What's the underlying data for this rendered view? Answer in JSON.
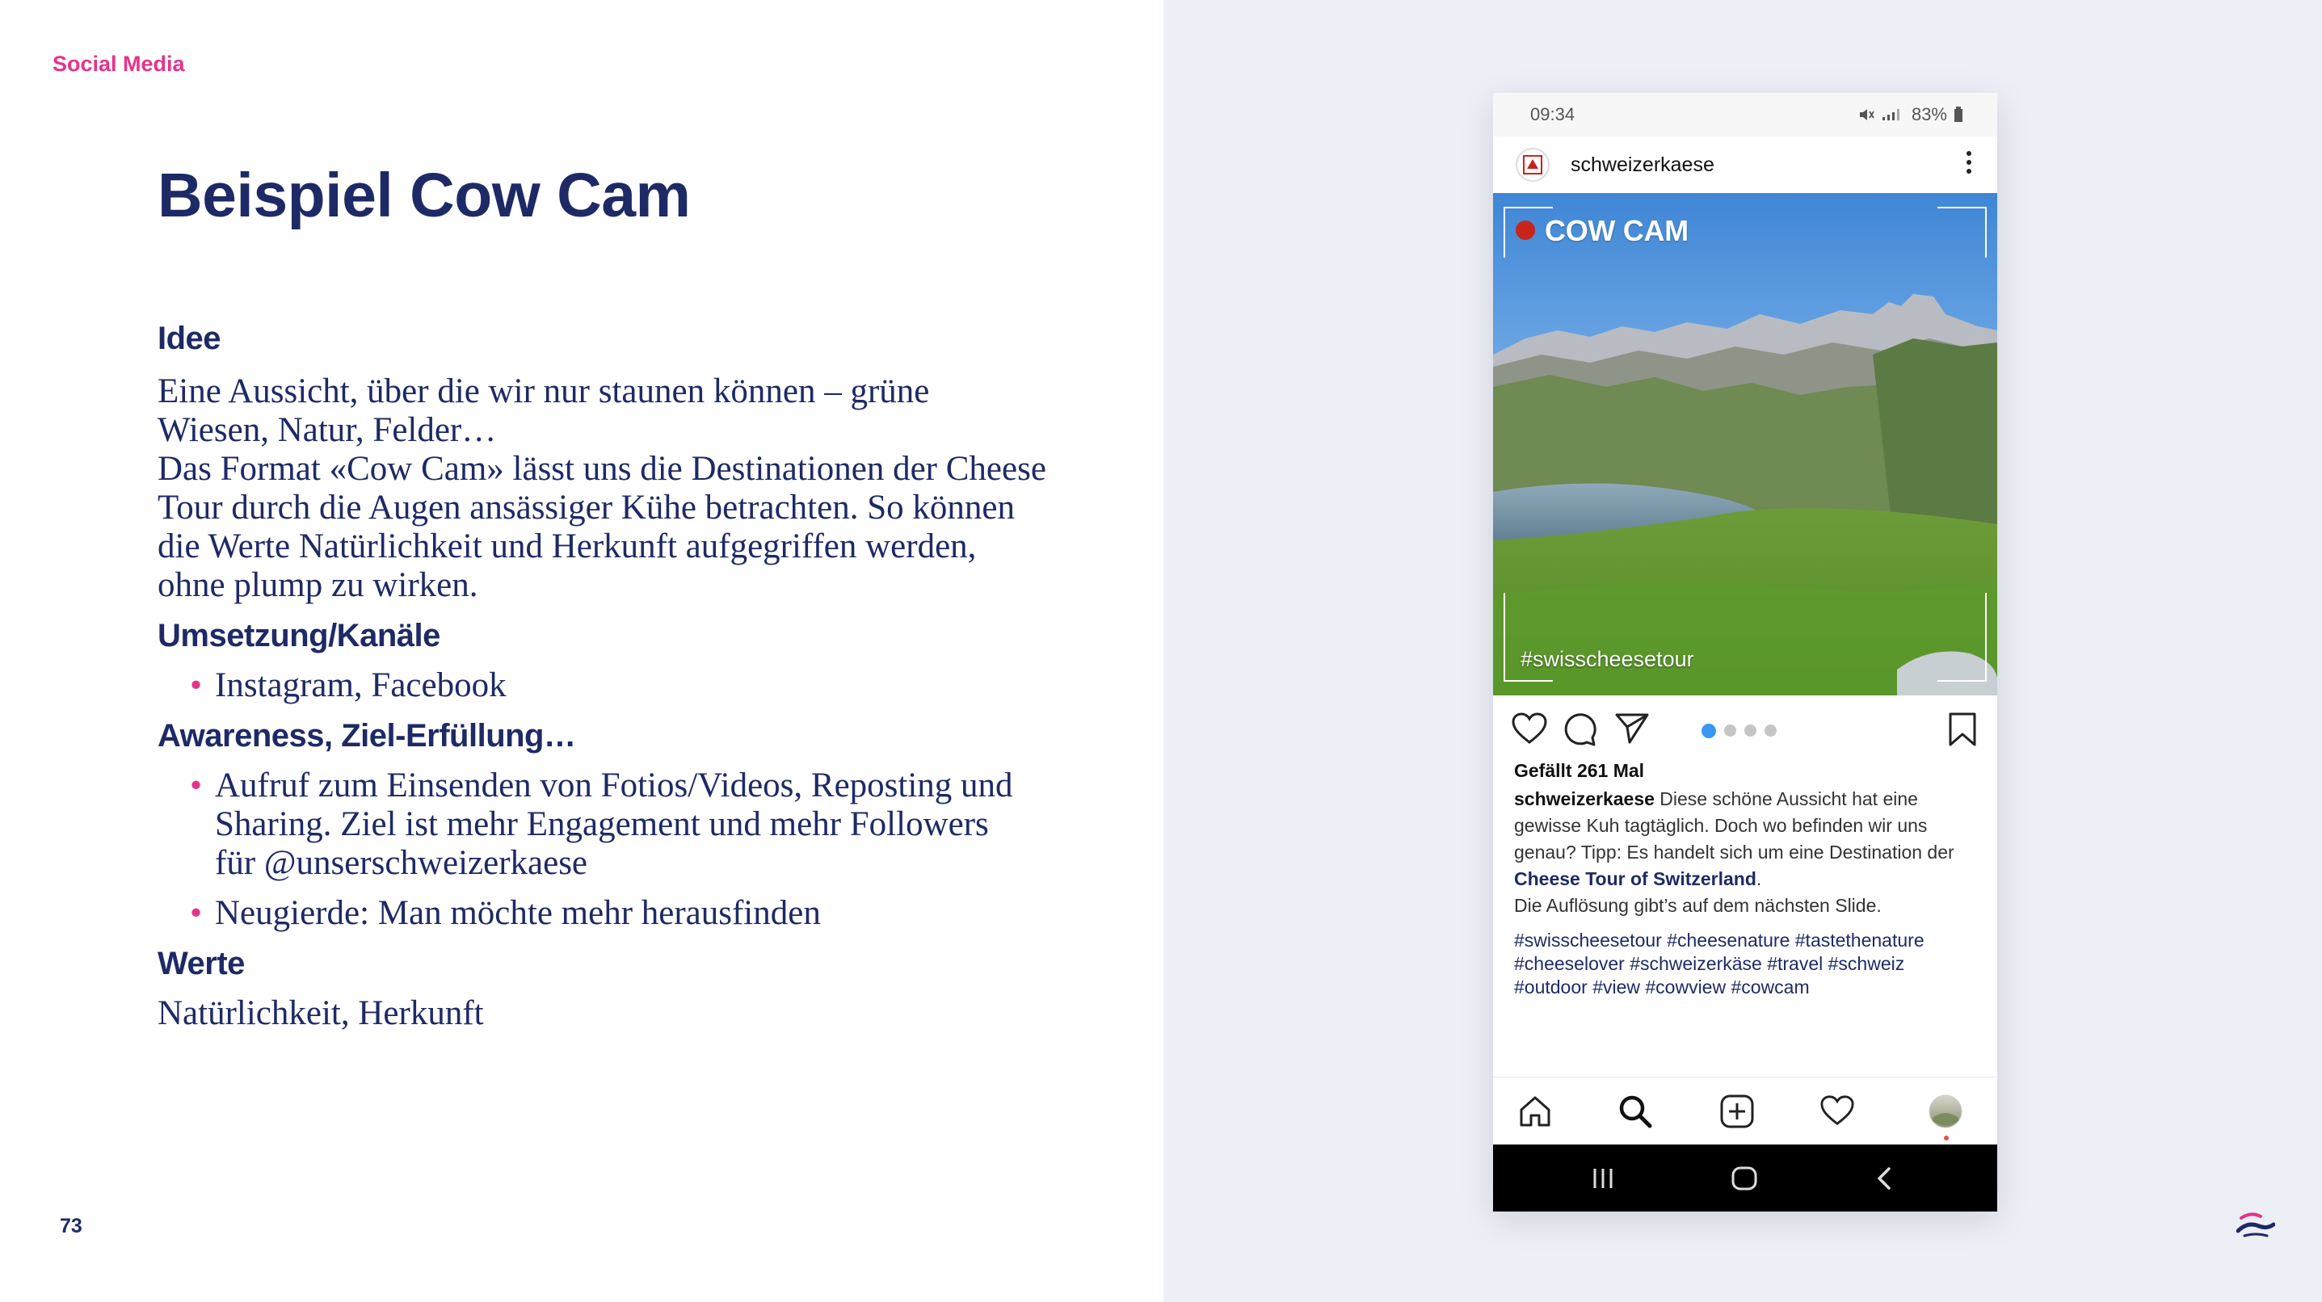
{
  "slide": {
    "section_label": "Social Media",
    "title": "Beispiel Cow Cam",
    "page_number": "73",
    "accent_color": "#e6338a",
    "text_color": "#1e2a66"
  },
  "content": {
    "idee_heading": "Idee",
    "idee_text_1": "Eine Aussicht, über die wir nur staunen können – grüne Wiesen, Natur, Felder…",
    "idee_text_2": "Das Format «Cow Cam» lässt uns die Destinationen der Cheese Tour durch die Augen ansässiger Kühe betrachten. So können die Werte Natürlichkeit und Herkunft aufgegriffen werden, ohne plump zu wirken.",
    "umsetzung_heading": "Umsetzung/Kanäle",
    "umsetzung_items": [
      "Instagram, Facebook"
    ],
    "awareness_heading": "Awareness, Ziel-Erfüllung…",
    "awareness_items": [
      "Aufruf zum Einsenden von Fotios/Videos, Reposting und Sharing. Ziel ist mehr Engagement und mehr Followers für @unserschweizerkaese",
      "Neugierde: Man möchte mehr herausfinden"
    ],
    "werte_heading": "Werte",
    "werte_text": "Natürlichkeit, Herkunft",
    "bullet_glyph": "•"
  },
  "phone": {
    "status_time": "09:34",
    "battery": "83%",
    "username": "schweizerkaese",
    "image_label": "COW CAM",
    "image_hashtag": "#swisscheesetour",
    "carousel_active_index": 0,
    "carousel_count": 4,
    "likes": "Gefällt 261 Mal",
    "caption_user": "schweizerkaese",
    "caption_text": "Diese schöne Aussicht hat eine gewisse Kuh tagtäglich. Doch wo befinden wir uns genau? Tipp: Es handelt sich um eine Destination der",
    "caption_link": "Cheese Tour of Switzerland",
    "caption_period": ".",
    "caption_text_2": "Die Auflösung gibt’s auf dem nächsten Slide.",
    "hashtags": "#swisscheesetour #cheesenature #tastethenature #cheeselover #schweizerkäse #travel #schweiz #outdoor #view #cowview #cowcam",
    "icons": {
      "like": "heart-icon",
      "comment": "comment-icon",
      "share": "send-icon",
      "save": "bookmark-icon",
      "nav_home": "home-icon",
      "nav_search": "search-icon",
      "nav_add": "add-post-icon",
      "nav_activity": "heart-icon",
      "nav_profile": "profile-avatar"
    }
  }
}
